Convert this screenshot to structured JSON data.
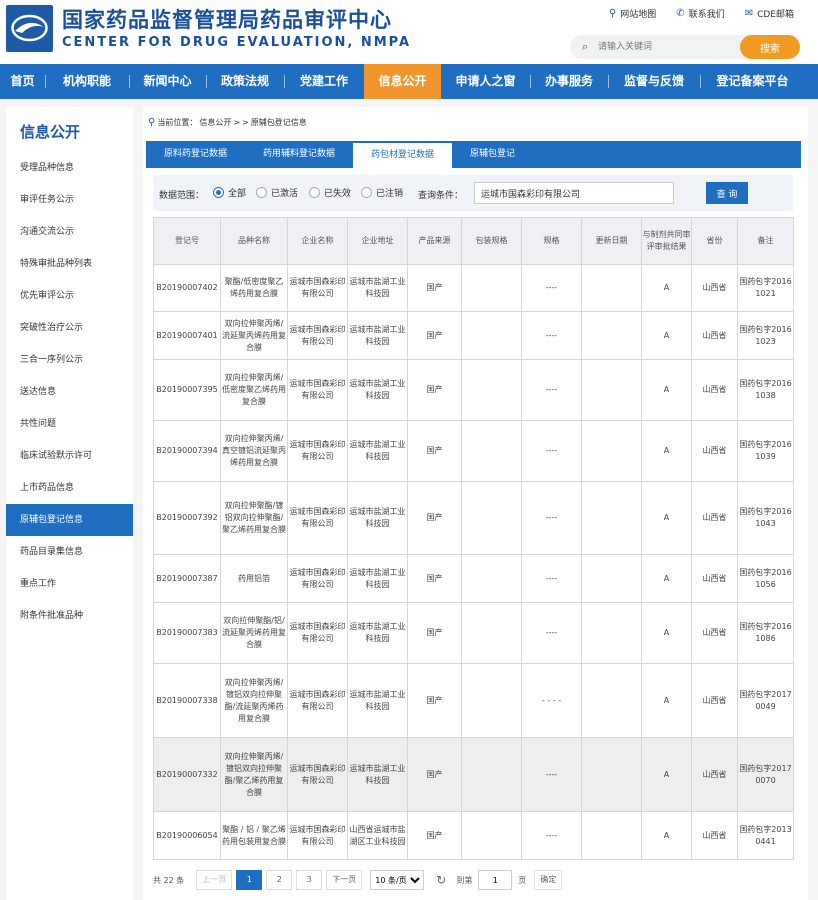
{
  "header": {
    "title_cn": "国家药品监督管理局药品审评中心",
    "title_en": "CENTER FOR DRUG EVALUATION, NMPA",
    "links": [
      "网站地图",
      "联系我们",
      "CDE邮箱"
    ],
    "search_placeholder": "请输入关键词",
    "search_button": "搜索"
  },
  "nav": {
    "items": [
      "首页",
      "机构职能",
      "新闻中心",
      "政策法规",
      "党建工作",
      "信息公开",
      "申请人之窗",
      "办事服务",
      "监督与反馈",
      "登记备案平台"
    ],
    "active": "信息公开"
  },
  "sidebar": {
    "title": "信息公开",
    "items": [
      "受理品种信息",
      "审评任务公示",
      "沟通交流公示",
      "特殊审批品种列表",
      "优先审评公示",
      "突破性治疗公示",
      "三合一序列公示",
      "送达信息",
      "共性问题",
      "临床试验默示许可",
      "上市药品信息",
      "原辅包登记信息",
      "药品目录集信息",
      "重点工作",
      "附条件批准品种"
    ],
    "active": "原辅包登记信息"
  },
  "breadcrumb": {
    "prefix": "当前位置：",
    "parts": [
      "信息公开",
      ">",
      ">",
      "原辅包登记信息"
    ]
  },
  "tabs": {
    "items": [
      "原料药登记数据",
      "药用辅料登记数据",
      "药包材登记数据",
      "原辅包登记"
    ],
    "active": "药包材登记数据"
  },
  "filter": {
    "range_label": "数据范围：",
    "options": [
      "全部",
      "已激活",
      "已失效",
      "已注销"
    ],
    "selected": "全部",
    "query_label": "查询条件：",
    "query_value": "运城市国森彩印有限公司",
    "query_button": "查 询"
  },
  "table": {
    "columns": [
      "登记号",
      "品种名称",
      "企业名称",
      "企业地址",
      "产品来源",
      "包装规格",
      "规格",
      "更新日期",
      "与制剂共同审评审批结果",
      "省份",
      "备注"
    ],
    "rows": [
      [
        "B20190007402",
        "聚酯/低密度聚乙烯药用复合膜",
        "运城市国森彩印有限公司",
        "运城市盐湖工业科技园",
        "国产",
        "",
        "----",
        "",
        "A",
        "山西省",
        "国药包字20161021"
      ],
      [
        "B20190007401",
        "双向拉伸聚丙烯/流延聚丙烯药用复合膜",
        "运城市国森彩印有限公司",
        "运城市盐湖工业科技园",
        "国产",
        "",
        "----",
        "",
        "A",
        "山西省",
        "国药包字20161023"
      ],
      [
        "B20190007395",
        "双向拉伸聚丙烯/低密度聚乙烯药用复合膜",
        "运城市国森彩印有限公司",
        "运城市盐湖工业科技园",
        "国产",
        "",
        "----",
        "",
        "A",
        "山西省",
        "国药包字20161038"
      ],
      [
        "B20190007394",
        "双向拉伸聚丙烯/真空镀铝流延聚丙烯药用复合膜",
        "运城市国森彩印有限公司",
        "运城市盐湖工业科技园",
        "国产",
        "",
        "----",
        "",
        "A",
        "山西省",
        "国药包字20161039"
      ],
      [
        "B20190007392",
        "双向拉伸聚酯/镀铝双向拉伸聚酯/聚乙烯药用复合膜",
        "运城市国森彩印有限公司",
        "运城市盐湖工业科技园",
        "国产",
        "",
        "----",
        "",
        "A",
        "山西省",
        "国药包字20161043"
      ],
      [
        "B20190007387",
        "药用铝箔",
        "运城市国森彩印有限公司",
        "运城市盐湖工业科技园",
        "国产",
        "",
        "----",
        "",
        "A",
        "山西省",
        "国药包字20161056"
      ],
      [
        "B20190007383",
        "双向拉伸聚酯/铝/流延聚丙烯药用复合膜",
        "运城市国森彩印有限公司",
        "运城市盐湖工业科技园",
        "国产",
        "",
        "----",
        "",
        "A",
        "山西省",
        "国药包字20161086"
      ],
      [
        "B20190007338",
        "双向拉伸聚丙烯/镀铝双向拉伸聚酯/流延聚丙烯药用复合膜",
        "运城市国森彩印有限公司",
        "运城市盐湖工业科技园",
        "国产",
        "",
        "- - - -",
        "",
        "A",
        "山西省",
        "国药包字20170049"
      ],
      [
        "B20190007332",
        "双向拉伸聚丙烯/镀铝双向拉伸聚酯/聚乙烯药用复合膜",
        "运城市国森彩印有限公司",
        "运城市盐湖工业科技园",
        "国产",
        "",
        "----",
        "",
        "A",
        "山西省",
        "国药包字20170070"
      ],
      [
        "B20190006054",
        "聚酯 / 铝 / 聚乙烯药用包装用复合膜",
        "运城市国森彩印有限公司",
        "山西省运城市盐湖区工业科技园",
        "国产",
        "",
        "----",
        "",
        "A",
        "山西省",
        "国药包字20130441"
      ]
    ]
  },
  "pager": {
    "total": "共 22 条",
    "prev": "上一页",
    "pages": [
      "1",
      "2",
      "3"
    ],
    "current": "1",
    "next": "下一页",
    "page_size": "10 条/页",
    "goto_label": "到第",
    "goto_value": "1",
    "page_unit": "页",
    "confirm": "确定"
  }
}
